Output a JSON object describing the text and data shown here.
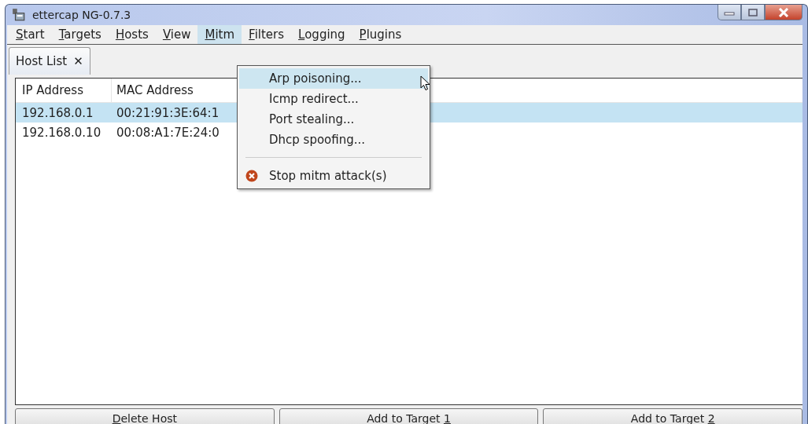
{
  "window": {
    "title": "ettercap NG-0.7.3"
  },
  "menu_bar": [
    {
      "label": "Start",
      "selected": false
    },
    {
      "label": "Targets",
      "selected": false
    },
    {
      "label": "Hosts",
      "selected": false
    },
    {
      "label": "View",
      "selected": false
    },
    {
      "label": "Mitm",
      "selected": true
    },
    {
      "label": "Filters",
      "selected": false
    },
    {
      "label": "Logging",
      "selected": false
    },
    {
      "label": "Plugins",
      "selected": false
    }
  ],
  "tabs": [
    {
      "label": "Host List",
      "close": "✕",
      "selected": true
    }
  ],
  "table": {
    "columns": [
      "IP Address",
      "MAC Address"
    ],
    "rows": [
      {
        "cells": [
          "192.168.0.1",
          "00:21:91:3E:64:1"
        ],
        "selected": true
      },
      {
        "cells": [
          "192.168.0.10",
          "00:08:A1:7E:24:0"
        ],
        "selected": false
      }
    ]
  },
  "dropdown": [
    {
      "kind": "item",
      "label": "Arp poisoning...",
      "selected": true
    },
    {
      "kind": "item",
      "label": "Icmp redirect...",
      "selected": false
    },
    {
      "kind": "item",
      "label": "Port stealing...",
      "selected": false
    },
    {
      "kind": "item",
      "label": "Dhcp spoofing...",
      "selected": false
    },
    {
      "kind": "separator"
    },
    {
      "kind": "stop",
      "label": "Stop mitm attack(s)",
      "selected": false
    }
  ],
  "buttons": [
    {
      "underlined": "D",
      "after": "elete Host"
    },
    {
      "before": "Add to Target ",
      "underlined": "1"
    },
    {
      "before": "Add to Target ",
      "underlined": "2"
    }
  ]
}
